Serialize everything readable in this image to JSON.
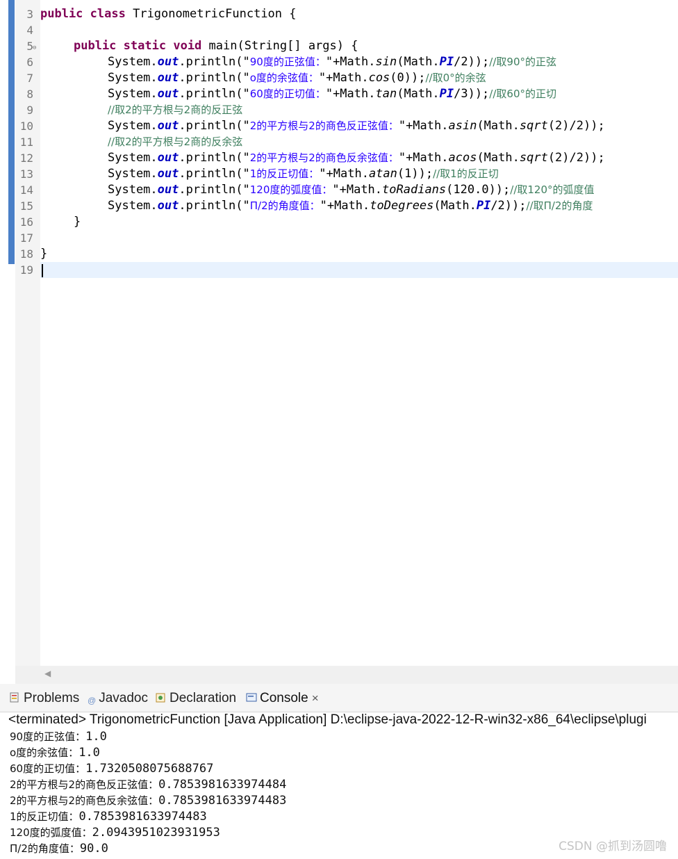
{
  "editor": {
    "line_numbers": [
      "3",
      "4",
      "5",
      "6",
      "7",
      "8",
      "9",
      "10",
      "11",
      "12",
      "13",
      "14",
      "15",
      "16",
      "17",
      "18",
      "19"
    ],
    "lines": [
      {
        "kw1": "public",
        "kw2": "class",
        "rest": " TrigonometricFunction {"
      },
      {},
      {
        "kw1": "public",
        "kw2": "static",
        "kw3": "void",
        "rest": " main(String[] args) {"
      },
      {
        "sys": "System.",
        "fld": "out",
        "p1": ".println(\"",
        "str": "90度的正弦值：",
        "p2": "\"+Math.",
        "mth": "sin",
        "p3": "(Math.",
        "fld2": "PI",
        "p4": "/2));",
        "cmt": "//取90°的正弦"
      },
      {
        "sys": "System.",
        "fld": "out",
        "p1": ".println(\"",
        "str": "o度的余弦值：",
        "p2": "\"+Math.",
        "mth": "cos",
        "p3": "(0));",
        "cmt": "//取0°的余弦"
      },
      {
        "sys": "System.",
        "fld": "out",
        "p1": ".println(\"",
        "str": "60度的正切值：",
        "p2": "\"+Math.",
        "mth": "tan",
        "p3": "(Math.",
        "fld2": "PI",
        "p4": "/3));",
        "cmt": "//取60°的正切"
      },
      {
        "cmt": "//取2的平方根与2商的反正弦"
      },
      {
        "sys": "System.",
        "fld": "out",
        "p1": ".println(\"",
        "str": "2的平方根与2的商色反正弦值：",
        "p2": "\"+Math.",
        "mth": "asin",
        "p3": "(Math.",
        "mth2": "sqrt",
        "p4": "(2)/2));"
      },
      {
        "cmt": "//取2的平方根与2商的反余弦"
      },
      {
        "sys": "System.",
        "fld": "out",
        "p1": ".println(\"",
        "str": "2的平方根与2的商色反余弦值：",
        "p2": "\"+Math.",
        "mth": "acos",
        "p3": "(Math.",
        "mth2": "sqrt",
        "p4": "(2)/2));"
      },
      {
        "sys": "System.",
        "fld": "out",
        "p1": ".println(\"",
        "str": "1的反正切值：",
        "p2": "\"+Math.",
        "mth": "atan",
        "p3": "(1));",
        "cmt": "//取1的反正切"
      },
      {
        "sys": "System.",
        "fld": "out",
        "p1": ".println(\"",
        "str": "120度的弧度值：",
        "p2": "\"+Math.",
        "mth": "toRadians",
        "p3": "(120.0));",
        "cmt": "//取120°的弧度值"
      },
      {
        "sys": "System.",
        "fld": "out",
        "p1": ".println(\"",
        "str": "Π/2的角度值：",
        "p2": "\"+Math.",
        "mth": "toDegrees",
        "p3": "(Math.",
        "fld2": "PI",
        "p4": "/2));",
        "cmt": "//取Π/2的角度"
      },
      {
        "rest": "}"
      },
      {},
      {
        "rest": "}"
      },
      {}
    ]
  },
  "panel": {
    "tabs": [
      {
        "label": "Problems",
        "icon": "problems-icon"
      },
      {
        "label": "Javadoc",
        "icon": "javadoc-icon"
      },
      {
        "label": "Declaration",
        "icon": "declaration-icon"
      },
      {
        "label": "Console",
        "icon": "console-icon",
        "close": "×"
      }
    ],
    "status": "<terminated> TrigonometricFunction [Java Application] D:\\eclipse-java-2022-12-R-win32-x86_64\\eclipse\\plugi",
    "output": [
      {
        "label": "90度的正弦值：",
        "value": "1.0"
      },
      {
        "label": "o度的余弦值：",
        "value": "1.0"
      },
      {
        "label": "60度的正切值：",
        "value": "1.7320508075688767"
      },
      {
        "label": "2的平方根与2的商色反正弦值：",
        "value": "0.7853981633974484"
      },
      {
        "label": "2的平方根与2的商色反余弦值：",
        "value": "0.7853981633974483"
      },
      {
        "label": "1的反正切值：",
        "value": "0.7853981633974483"
      },
      {
        "label": "120度的弧度值：",
        "value": "2.0943951023931953"
      },
      {
        "label": "Π/2的角度值：",
        "value": "90.0"
      }
    ]
  },
  "watermark": "CSDN @抓到汤圆噜"
}
